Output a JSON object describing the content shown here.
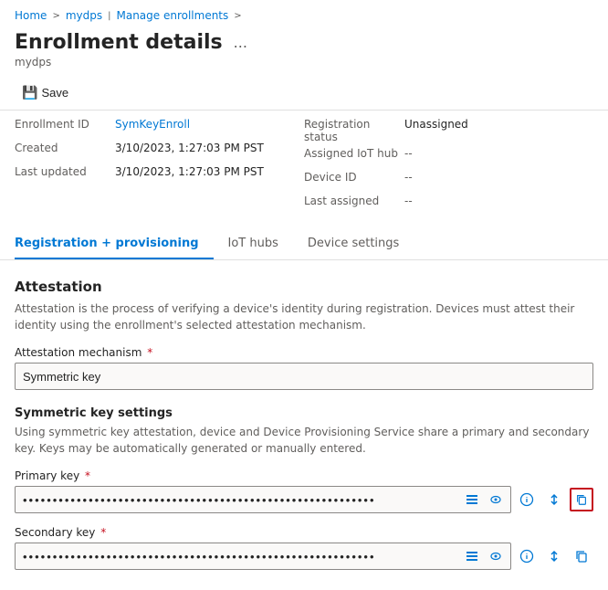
{
  "breadcrumb": {
    "home": "Home",
    "mydps": "mydps",
    "separator1": ">",
    "manage": "Manage enrollments",
    "separator2": ">"
  },
  "header": {
    "title": "Enrollment details",
    "ellipsis": "...",
    "subtitle": "mydps"
  },
  "toolbar": {
    "save_label": "Save"
  },
  "details": {
    "left": [
      {
        "label": "Enrollment ID",
        "value": "SymKeyEnroll",
        "type": "link"
      },
      {
        "label": "Created",
        "value": "3/10/2023, 1:27:03 PM PST",
        "type": "plain"
      },
      {
        "label": "Last updated",
        "value": "3/10/2023, 1:27:03 PM PST",
        "type": "plain"
      }
    ],
    "right": [
      {
        "label": "Registration status",
        "value": "Unassigned",
        "type": "plain"
      },
      {
        "label": "Assigned IoT hub",
        "value": "--",
        "type": "muted"
      },
      {
        "label": "Device ID",
        "value": "--",
        "type": "muted"
      },
      {
        "label": "Last assigned",
        "value": "--",
        "type": "muted"
      }
    ]
  },
  "tabs": [
    {
      "id": "registration",
      "label": "Registration + provisioning",
      "active": true
    },
    {
      "id": "iothubs",
      "label": "IoT hubs",
      "active": false
    },
    {
      "id": "devicesettings",
      "label": "Device settings",
      "active": false
    }
  ],
  "attestation": {
    "section_title": "Attestation",
    "section_desc": "Attestation is the process of verifying a device's identity during registration. Devices must attest their identity using the enrollment's selected attestation mechanism.",
    "mechanism_label": "Attestation mechanism",
    "mechanism_required": "*",
    "mechanism_value": "Symmetric key",
    "subsection_title": "Symmetric key settings",
    "subsection_desc": "Using symmetric key attestation, device and Device Provisioning Service share a primary and secondary key. Keys may be automatically generated or manually entered.",
    "primary_key_label": "Primary key",
    "primary_key_required": "*",
    "primary_key_dots": "••••••••••••••••••••••••••••••••••••••••••••••••••••••••••••••••",
    "secondary_key_label": "Secondary key",
    "secondary_key_required": "*",
    "secondary_key_dots": "••••••••••••••••••••••••••••••••••••••••••••••••••••••••••••••••",
    "icons": {
      "show": "👁",
      "regenerate": "↕",
      "copy": "⧉",
      "info": "ℹ"
    }
  }
}
